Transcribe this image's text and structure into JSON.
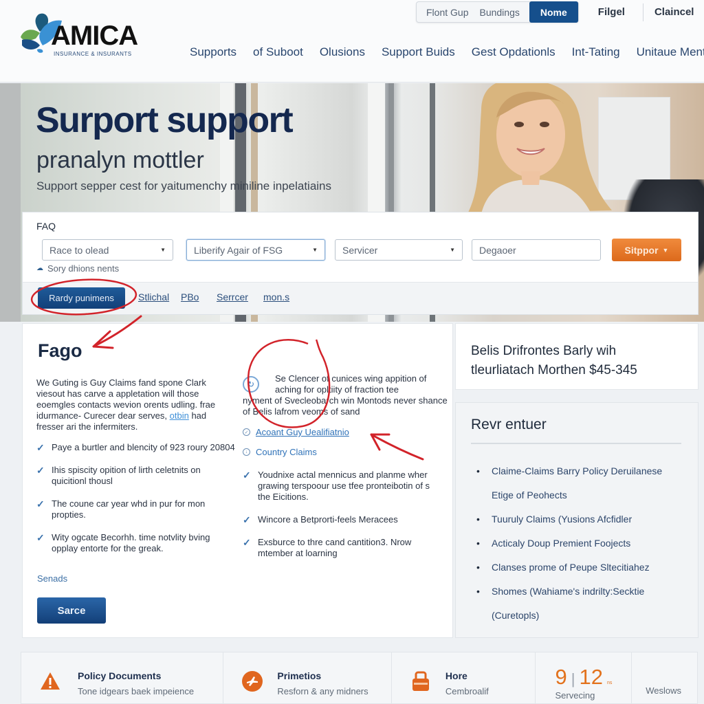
{
  "brand": {
    "name": "AMICA",
    "tagline": "Insurance & Insurants",
    "colors": {
      "primary": "#154f8c",
      "accent": "#e2721d",
      "annotation": "#d2232a"
    }
  },
  "header": {
    "utility_links": [
      "Flont Gup",
      "Bundings"
    ],
    "utility_active": "Nome",
    "utility_extra": [
      "Filgel",
      "Claincel"
    ],
    "nav": [
      "Supports",
      "of Suboot",
      "Olusions",
      "Support Buids",
      "Gest Opdationls",
      "Int-Tating",
      "Unitaue Ment"
    ]
  },
  "hero": {
    "title": "Surport support",
    "subtitle": "pranalyn mottler",
    "description": "Support sepper cest for yaitumenchy miniline inpelatiains",
    "image": "smiling-woman-photo"
  },
  "faq_search": {
    "label": "FAQ",
    "fields": [
      {
        "value": "Race to olead",
        "type": "select"
      },
      {
        "value": "Liberify Agair of FSG",
        "type": "select"
      },
      {
        "value": "Servicer",
        "type": "select"
      },
      {
        "value": "Degaoer",
        "type": "text"
      }
    ],
    "submit_label": "Sitppor",
    "hint": "Sory dhions nents"
  },
  "tabs": {
    "active": "Rardy punimens",
    "items": [
      "Stlichal",
      "PBo",
      "Serrcer",
      "mon.s"
    ]
  },
  "main": {
    "title": "Fago",
    "intro_before_link": "We Guting is Guy Claims fand spone Clark viesout has carve a appletation will those eoemgles contacts wevion orents udling. frae idurmance- Curecer dear serves, ",
    "intro_link": "otbin",
    "intro_after_link": " had fresser ari the infermiters.",
    "checks_left": [
      "Paye a burtler and blencity of 923 roury 20804",
      "Ihis spiscity opition of lirth celetnits on quicitionl thousl",
      "The coune car year whd in pur for mon propties.",
      "Wity ogcate Becorhh. time notvlity bving opplay entorte for the greak."
    ],
    "more_link": "Senads",
    "action_button": "Sarce",
    "col2_para_line1": "Se Clencer of cunices wing appition of aching for opltiity of fraction tee",
    "col2_para_line2": "nyment of Svecleobarch win Montods never shance of Belis lafrom veoms of sand",
    "col2_links": [
      "Acoant Guy Uealifiatnio",
      "Country Claims"
    ],
    "checks_right": [
      "Youdnixe actal mennicus and planme wher grawing terspoour use tfee pronteibotin of s the Eicitions.",
      "Wincore a Betprorti-feels Meracees",
      "Exsburce to thre cand cantition3. Nrow mtember at loarning"
    ]
  },
  "promo": {
    "line1": "Belis Drifrontes Barly wih",
    "line2": "tleurliatach Morthen $45-345"
  },
  "sidebox": {
    "title": "Revr entuer",
    "items": [
      "Claime-Claims Barry Policy Deruilanese Etige of Peohects",
      "Tuuruly Claims (Yusions Afcfidler",
      "Acticaly Doup Premient Foojects",
      "Clanses prome of Peupe Sltecitiahez",
      "Shomes (Wahiame's indrilty:Secktie (Curetopls)"
    ]
  },
  "footer": {
    "cards": [
      {
        "icon": "warning-icon",
        "title": "Policy Documents",
        "subtitle": "Tone idgears baek impeience"
      },
      {
        "icon": "plane-icon",
        "title": "Primetios",
        "subtitle": "Resforn & any midners"
      },
      {
        "icon": "lock-icon",
        "title": "Hore",
        "subtitle": "Cembroalif"
      }
    ],
    "stat": {
      "value1": "9",
      "value2": "12",
      "unit": "ns",
      "label": "Servecing"
    },
    "last_label": "Weslows"
  }
}
